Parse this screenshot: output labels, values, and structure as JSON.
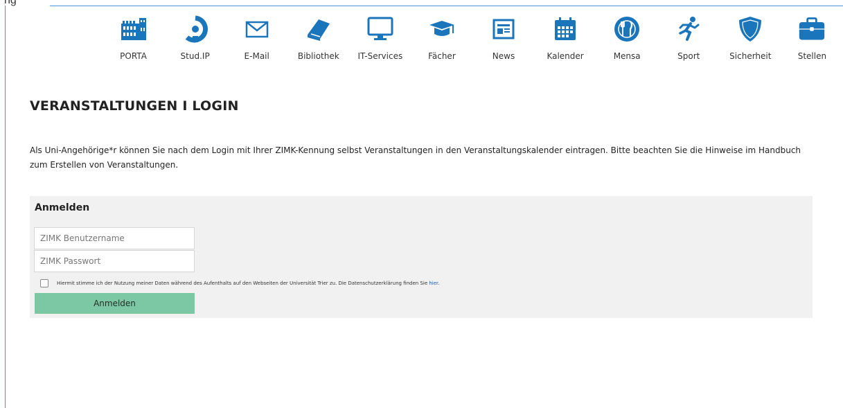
{
  "frame": {
    "top_label": "ng"
  },
  "quicklinks": [
    {
      "label": "PORTA",
      "icon": "building-icon"
    },
    {
      "label": "Stud.IP",
      "icon": "studip-icon"
    },
    {
      "label": "E-Mail",
      "icon": "envelope-icon"
    },
    {
      "label": "Bibliothek",
      "icon": "book-icon"
    },
    {
      "label": "IT-Services",
      "icon": "monitor-icon"
    },
    {
      "label": "Fächer",
      "icon": "graduation-cap-icon"
    },
    {
      "label": "News",
      "icon": "newspaper-icon"
    },
    {
      "label": "Kalender",
      "icon": "calendar-icon"
    },
    {
      "label": "Mensa",
      "icon": "fork-knife-icon"
    },
    {
      "label": "Sport",
      "icon": "runner-icon"
    },
    {
      "label": "Sicherheit",
      "icon": "shield-icon"
    },
    {
      "label": "Stellen",
      "icon": "briefcase-icon"
    }
  ],
  "page_title": "VERANSTALTUNGEN I LOGIN",
  "intro_text": "Als Uni-Angehörige*r können Sie nach dem Login mit Ihrer ZIMK-Kennung selbst Veranstaltungen in den Veranstaltungskalender eintragen. Bitte beachten Sie die Hinweise im Handbuch zum Erstellen von Veranstaltungen.",
  "login": {
    "heading": "Anmelden",
    "username_placeholder": "ZIMK Benutzername",
    "username_value": "",
    "password_placeholder": "ZIMK Passwort",
    "password_value": "",
    "consent_text": "Hiermit stimme ich der Nutzung meiner Daten während des Aufenthalts auf den Webseiten der Universität Trier zu. Die Datenschutzerklärung finden Sie ",
    "consent_link": "hier",
    "consent_end": ".",
    "consent_checked": false,
    "submit_label": "Anmelden"
  },
  "colors": {
    "icon_blue": "#1b75bb",
    "button_green": "#7cc8a4",
    "panel_gray": "#f1f1f1",
    "frame_blue": "#4a90d9"
  }
}
